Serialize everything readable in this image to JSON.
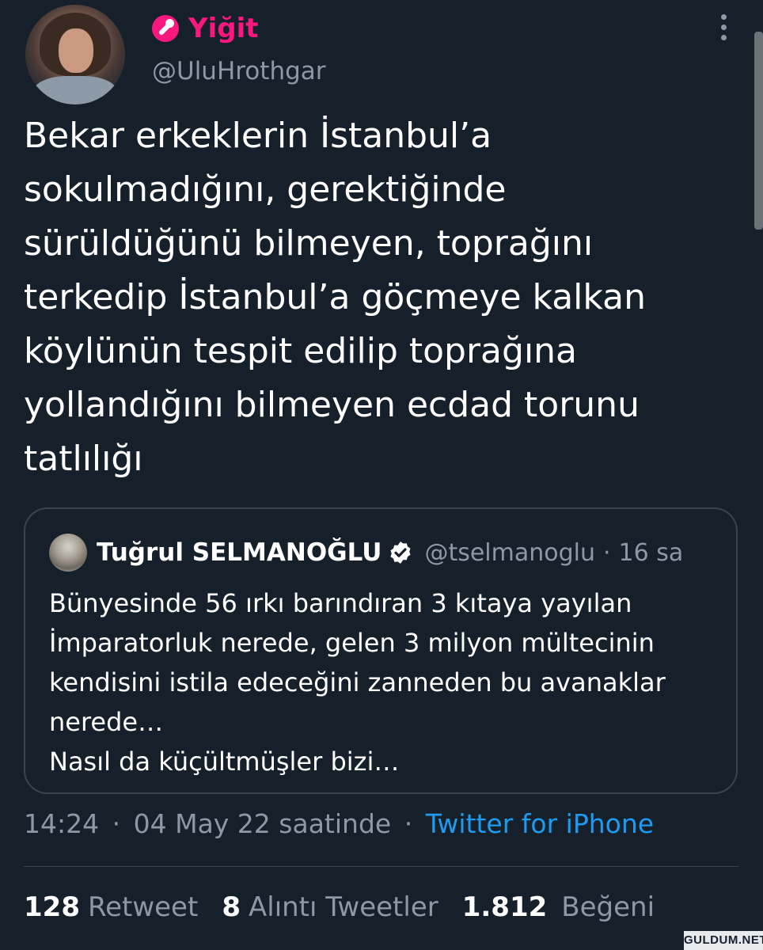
{
  "author": {
    "display_name": "Yiğit",
    "handle": "@UluHrothgar",
    "name_icon": "paintbrush-emoji-icon",
    "name_color": "#f91880"
  },
  "tweet": {
    "lines": [
      "Bekar erkeklerin İstanbul’a",
      "sokulmadığını, gerektiğinde",
      "sürüldüğünü bilmeyen, toprağını",
      "terkedip İstanbul’a göçmeye kalkan",
      "köylünün tespit edilip toprağına",
      "yollandığını bilmeyen ecdad torunu",
      "tatlılığı"
    ]
  },
  "quote": {
    "name": "Tuğrul SELMANOĞLU",
    "verified_icon": "verified-badge-icon",
    "handle": "@tselmanoglu",
    "separator": "·",
    "time": "16 sa",
    "lines": [
      "Bünyesinde 56 ırkı barındıran 3 kıtaya yayılan",
      "İmparatorluk nerede, gelen 3 milyon mültecinin",
      "kendisini istila edeceğini zanneden bu avanaklar",
      "nerede…",
      "Nasıl da küçültmüşler bizi…"
    ]
  },
  "meta": {
    "time": "14:24",
    "separator": "·",
    "date": "04 May 22 saatinde",
    "source": "Twitter for iPhone"
  },
  "stats": {
    "retweets": {
      "count": "128",
      "label": "Retweet"
    },
    "quotes": {
      "count": "8",
      "label": "Alıntı Tweetler"
    },
    "likes": {
      "count": "1.812",
      "label": "Beğeni"
    }
  },
  "watermark": "GULDUM.NET",
  "colors": {
    "background": "#15202b",
    "muted": "#8b98a5",
    "link": "#1d9bf0",
    "border": "#38444d"
  }
}
